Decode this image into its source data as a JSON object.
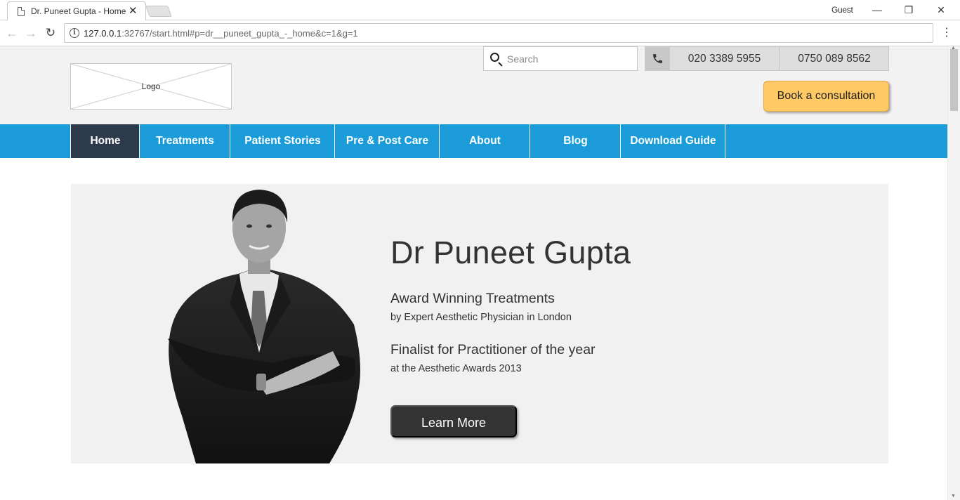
{
  "browser": {
    "tab_title": "Dr. Puneet Gupta - Home",
    "profile_label": "Guest",
    "url_host": "127.0.0.1",
    "url_rest": ":32767/start.html#p=dr__puneet_gupta_-_home&c=1&g=1",
    "close_glyph": "✕",
    "minimize_glyph": "—",
    "restore_glyph": "❐",
    "back_glyph": "←",
    "forward_glyph": "→",
    "reload_glyph": "↻",
    "menu_glyph": "⋮"
  },
  "header": {
    "logo_text": "Logo",
    "search_placeholder": "Search",
    "phones": [
      "020 3389 5955",
      "0750 089 8562"
    ],
    "book_button": "Book a consultation"
  },
  "nav": {
    "items": [
      {
        "label": "Home",
        "active": true
      },
      {
        "label": "Treatments"
      },
      {
        "label": "Patient Stories"
      },
      {
        "label": "Pre & Post Care"
      },
      {
        "label": "About"
      },
      {
        "label": "Blog"
      },
      {
        "label": "Download Guide"
      }
    ]
  },
  "hero": {
    "title": "Dr Puneet Gupta",
    "award_heading": "Award Winning Treatments",
    "award_sub": "by Expert Aesthetic Physician in London",
    "finalist_heading": "Finalist for Practitioner of the year",
    "finalist_sub": "at the Aesthetic Awards 2013",
    "cta_label": "Learn More"
  },
  "colors": {
    "nav_bg": "#1b9cd8",
    "nav_active": "#2d3a4b",
    "book_button": "#ffc965",
    "cta_button": "#333333",
    "header_bg": "#f2f2f2"
  }
}
